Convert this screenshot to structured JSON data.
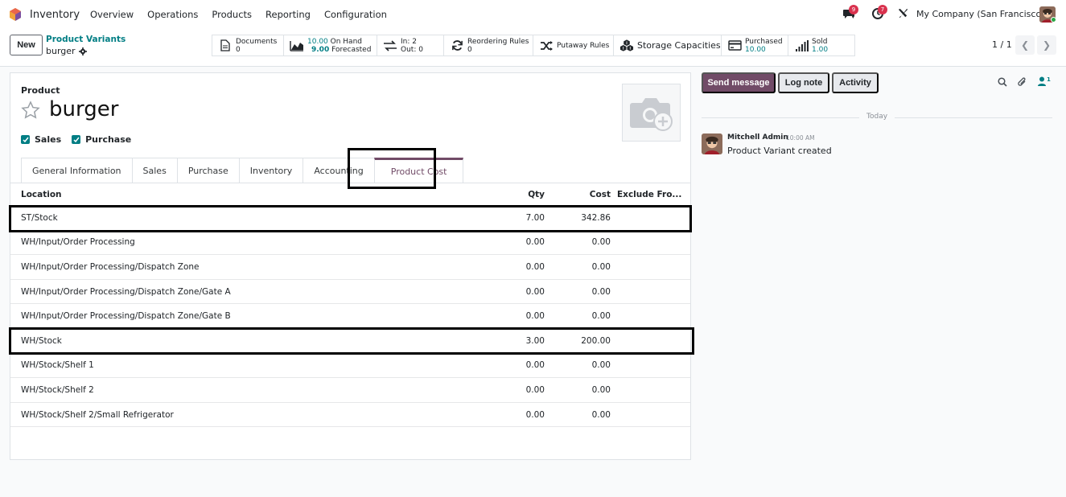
{
  "navbar": {
    "app_name": "Inventory",
    "menu": [
      "Overview",
      "Operations",
      "Products",
      "Reporting",
      "Configuration"
    ],
    "messages_badge": "9",
    "activity_badge": "7",
    "company": "My Company (San Francisco)"
  },
  "control": {
    "new_label": "New",
    "breadcrumb_parent": "Product Variants",
    "breadcrumb_current": "burger",
    "smart_buttons": {
      "documents": {
        "label": "Documents",
        "value": "0"
      },
      "on_hand": {
        "value": "10.00",
        "label": "On Hand",
        "forecast_value": "9.00",
        "forecast_label": "Forecasted"
      },
      "moves": {
        "in": "In: 2",
        "out": "Out: 0"
      },
      "reordering": {
        "label": "Reordering Rules",
        "value": "0"
      },
      "putaway": {
        "label": "Putaway Rules"
      },
      "storage": {
        "label": "Storage Capacities"
      },
      "purchased": {
        "label": "Purchased",
        "value": "10.00"
      },
      "sold": {
        "label": "Sold",
        "value": "1.00"
      }
    },
    "pager": "1 / 1"
  },
  "form": {
    "product_label": "Product",
    "product_name": "burger",
    "sales_label": "Sales",
    "purchase_label": "Purchase",
    "tabs": [
      "General Information",
      "Sales",
      "Purchase",
      "Inventory",
      "Accounting",
      "Product Cost"
    ],
    "table": {
      "headers": {
        "location": "Location",
        "qty": "Qty",
        "cost": "Cost",
        "exclude": "Exclude Fro..."
      },
      "rows": [
        {
          "location": "ST/Stock",
          "qty": "7.00",
          "cost": "342.86"
        },
        {
          "location": "WH/Input/Order Processing",
          "qty": "0.00",
          "cost": "0.00"
        },
        {
          "location": "WH/Input/Order Processing/Dispatch Zone",
          "qty": "0.00",
          "cost": "0.00"
        },
        {
          "location": "WH/Input/Order Processing/Dispatch Zone/Gate A",
          "qty": "0.00",
          "cost": "0.00"
        },
        {
          "location": "WH/Input/Order Processing/Dispatch Zone/Gate B",
          "qty": "0.00",
          "cost": "0.00"
        },
        {
          "location": "WH/Stock",
          "qty": "3.00",
          "cost": "200.00"
        },
        {
          "location": "WH/Stock/Shelf 1",
          "qty": "0.00",
          "cost": "0.00"
        },
        {
          "location": "WH/Stock/Shelf 2",
          "qty": "0.00",
          "cost": "0.00"
        },
        {
          "location": "WH/Stock/Shelf 2/Small Refrigerator",
          "qty": "0.00",
          "cost": "0.00"
        }
      ]
    }
  },
  "chatter": {
    "send_message": "Send message",
    "log_note": "Log note",
    "activity": "Activity",
    "followers_count": "1",
    "today": "Today",
    "message": {
      "author": "Mitchell Admin",
      "time": "10:00 AM",
      "body": "Product Variant created"
    }
  }
}
